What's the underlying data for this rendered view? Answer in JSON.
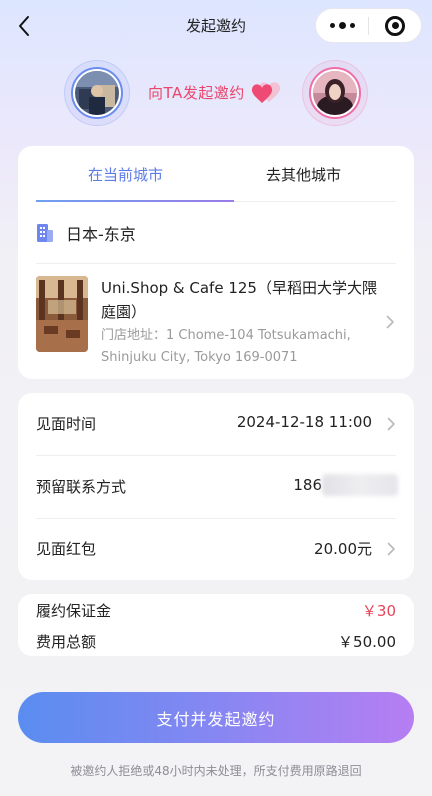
{
  "nav": {
    "title": "发起邀约"
  },
  "invite": {
    "label": "向TA发起邀约"
  },
  "tabs": [
    {
      "label": "在当前城市",
      "active": true
    },
    {
      "label": "去其他城市",
      "active": false
    }
  ],
  "location": {
    "city": "日本-东京"
  },
  "shop": {
    "name": "Uni.Shop & Cafe 125（早稻田大学大隈庭園）",
    "address": "门店地址：1 Chome-104 Totsukamachi, Shinjuku City, Tokyo 169-0071"
  },
  "details": {
    "meet_time_label": "见面时间",
    "meet_time_value": "2024-12-18 11:00",
    "contact_label": "预留联系方式",
    "contact_value": "186",
    "redpacket_label": "见面红包",
    "redpacket_value": "20.00元"
  },
  "fees": {
    "deposit_label": "履约保证金",
    "deposit_value": "￥30",
    "total_label": "费用总额",
    "total_value": "￥50.00"
  },
  "actions": {
    "pay_button": "支付并发起邀约"
  },
  "footnote": "被邀约人拒绝或48小时内未处理，所支付费用原路退回",
  "colors": {
    "accent_blue": "#5c7ce8",
    "accent_pink": "#e8466c",
    "deposit_red": "#e8455a"
  }
}
